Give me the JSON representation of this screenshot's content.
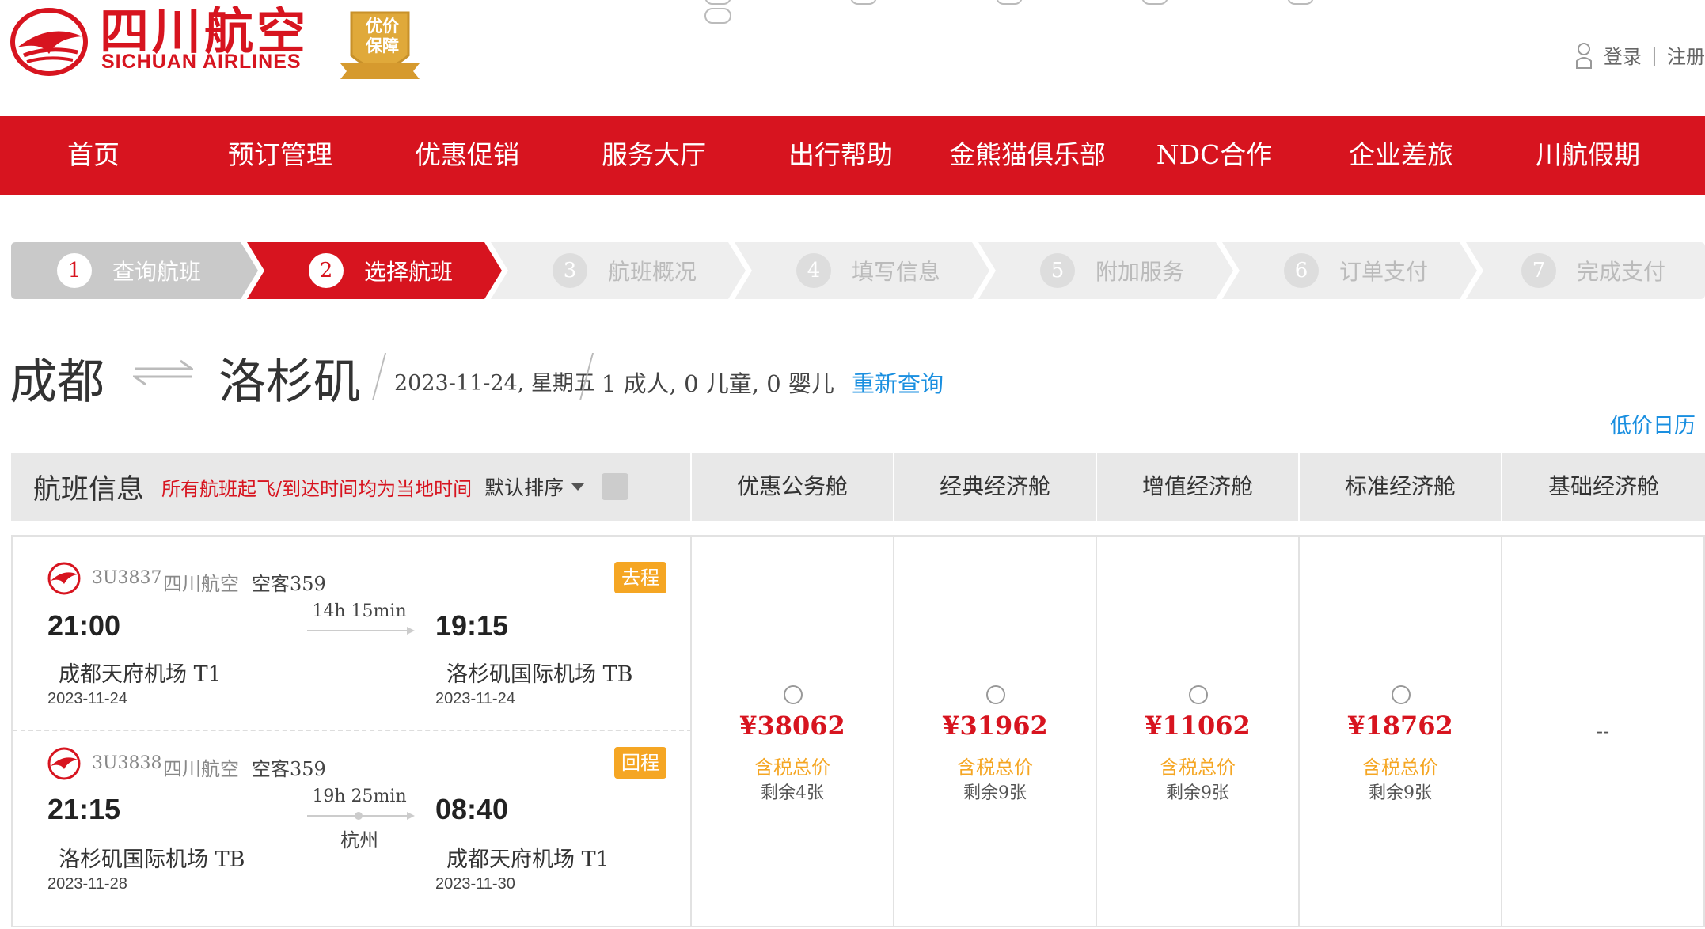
{
  "header": {
    "brand_cn": "四川航空",
    "brand_en": "SICHUAN AIRLINES",
    "badge_text": "优价保障",
    "login": "登录",
    "separator": "|",
    "register": "注册"
  },
  "nav": [
    "首页",
    "预订管理",
    "优惠促销",
    "服务大厅",
    "出行帮助",
    "金熊猫俱乐部",
    "NDC合作",
    "企业差旅",
    "川航假期"
  ],
  "steps": [
    {
      "num": "1",
      "label": "查询航班",
      "state": "done"
    },
    {
      "num": "2",
      "label": "选择航班",
      "state": "active"
    },
    {
      "num": "3",
      "label": "航班概况",
      "state": "pending"
    },
    {
      "num": "4",
      "label": "填写信息",
      "state": "pending"
    },
    {
      "num": "5",
      "label": "附加服务",
      "state": "pending"
    },
    {
      "num": "6",
      "label": "订单支付",
      "state": "pending"
    },
    {
      "num": "7",
      "label": "完成支付",
      "state": "pending"
    }
  ],
  "route": {
    "from": "成都",
    "to": "洛杉矶",
    "date": "2023-11-24, 星期五",
    "passengers": "1 成人, 0 儿童, 0 婴儿",
    "requery": "重新查询",
    "low_price_calendar": "低价日历"
  },
  "table": {
    "title": "航班信息",
    "note": "所有航班起飞/到达时间均为当地时间",
    "sort": "默认排序",
    "cabins": [
      "优惠公务舱",
      "经典经济舱",
      "增值经济舱",
      "标准经济舱",
      "基础经济舱"
    ]
  },
  "flights": [
    {
      "flight_no": "3U3837",
      "carrier": "四川航空",
      "aircraft": "空客359",
      "tag": "去程",
      "dep_time": "21:00",
      "arr_time": "19:15",
      "duration": "14h 15min",
      "stop": "",
      "dep_airport": "成都天府机场  T1",
      "arr_airport": "洛杉矶国际机场  TB",
      "dep_date": "2023-11-24",
      "arr_date": "2023-11-24"
    },
    {
      "flight_no": "3U3838",
      "carrier": "四川航空",
      "aircraft": "空客359",
      "tag": "回程",
      "dep_time": "21:15",
      "arr_time": "08:40",
      "duration": "19h 25min",
      "stop": "杭州",
      "dep_airport": "洛杉矶国际机场  TB",
      "arr_airport": "成都天府机场  T1",
      "dep_date": "2023-11-28",
      "arr_date": "2023-11-30"
    }
  ],
  "prices": [
    {
      "price": "¥38062",
      "tax": "含税总价",
      "left": "剩余4张"
    },
    {
      "price": "¥31962",
      "tax": "含税总价",
      "left": "剩余9张"
    },
    {
      "price": "¥11062",
      "tax": "含税总价",
      "left": "剩余9张"
    },
    {
      "price": "¥18762",
      "tax": "含税总价",
      "left": "剩余9张"
    },
    {
      "none": "--"
    }
  ],
  "colors": {
    "brand_red": "#d7141f",
    "link_blue": "#1a8fe0",
    "tag_orange": "#f5a623",
    "step_done": "#c9c9c9",
    "step_pending": "#eeeeee"
  }
}
